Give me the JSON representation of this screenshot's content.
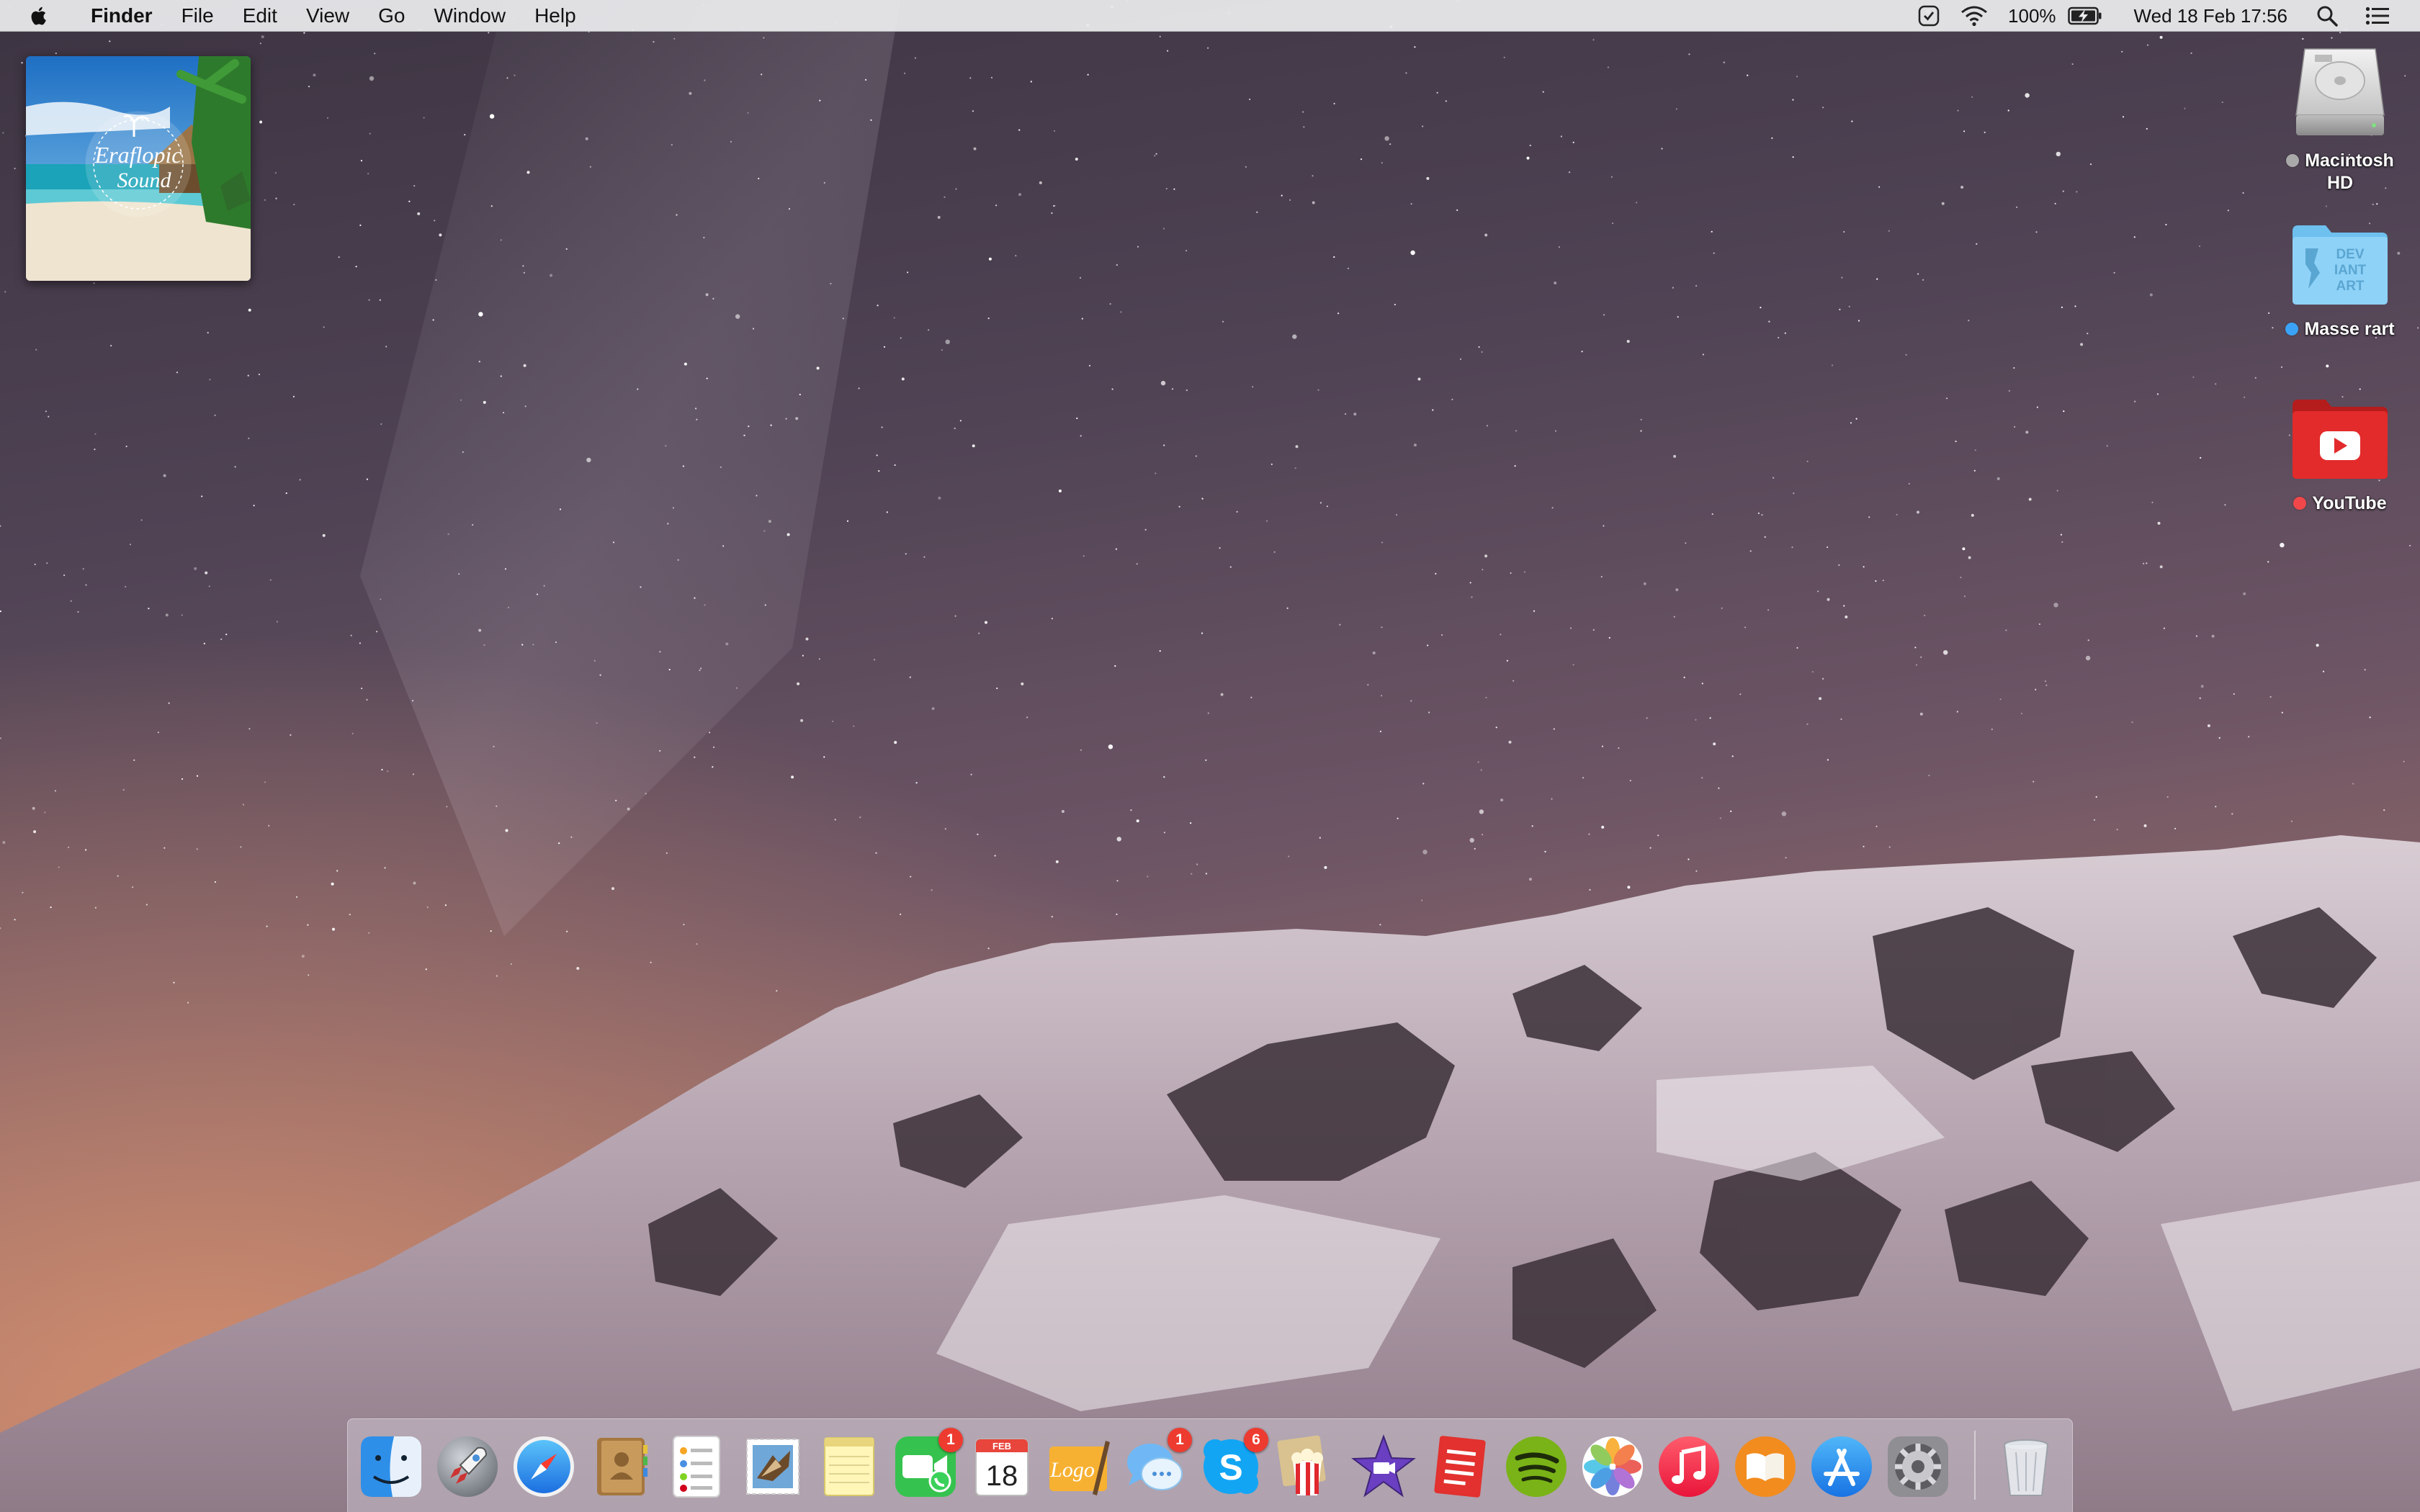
{
  "menubar": {
    "app_name": "Finder",
    "menus": [
      "File",
      "Edit",
      "View",
      "Go",
      "Window",
      "Help"
    ],
    "battery_percent": "100%",
    "datetime": "Wed 18 Feb  17:56",
    "status_icons": [
      "clock-check-icon",
      "wifi-icon",
      "battery-charging-icon",
      "spotlight-search-icon",
      "notification-center-icon"
    ]
  },
  "widgets": {
    "album_art": {
      "line1": "Eraflopic",
      "line2": "Sound"
    }
  },
  "desktop_icons": [
    {
      "name": "Macintosh HD",
      "label_lines": [
        "Macintosh",
        "HD"
      ],
      "tag_color": "#a9a9a9",
      "icon": "hard-drive-icon"
    },
    {
      "name": "Masse rart",
      "label_lines": [
        "Masse rart"
      ],
      "tag_color": "#3ba3f5",
      "icon": "deviantart-folder-icon",
      "folder_text": [
        "DEV",
        "IANT",
        "ART"
      ]
    },
    {
      "name": "YouTube",
      "label_lines": [
        "YouTube"
      ],
      "tag_color": "#f0484a",
      "icon": "youtube-folder-icon"
    }
  ],
  "dock": {
    "calendar_month": "FEB",
    "calendar_day": "18",
    "logo_app_text": "Logo",
    "apps": [
      {
        "id": "finder",
        "icon": "finder-icon",
        "running": true
      },
      {
        "id": "launchpad",
        "icon": "launchpad-rocket-icon",
        "running": false
      },
      {
        "id": "safari",
        "icon": "safari-compass-icon",
        "running": true
      },
      {
        "id": "contacts",
        "icon": "contacts-book-icon",
        "running": false
      },
      {
        "id": "reminders",
        "icon": "reminders-list-icon",
        "running": false
      },
      {
        "id": "mail",
        "icon": "mail-stamp-icon",
        "running": false
      },
      {
        "id": "notes",
        "icon": "notes-pad-icon",
        "running": false
      },
      {
        "id": "facetime",
        "icon": "facetime-icon",
        "running": true,
        "badge": "1"
      },
      {
        "id": "calendar",
        "icon": "calendar-icon",
        "running": true
      },
      {
        "id": "logoist",
        "icon": "logo-design-icon",
        "running": true
      },
      {
        "id": "messages",
        "icon": "messages-bubble-icon",
        "running": true,
        "badge": "1"
      },
      {
        "id": "skype",
        "icon": "skype-icon",
        "running": true,
        "badge": "6"
      },
      {
        "id": "popcorn",
        "icon": "popcorn-icon",
        "running": true
      },
      {
        "id": "imovie",
        "icon": "imovie-star-icon",
        "running": true
      },
      {
        "id": "todo",
        "icon": "todo-list-icon",
        "running": true
      },
      {
        "id": "spotify",
        "icon": "spotify-icon",
        "running": true
      },
      {
        "id": "photos",
        "icon": "photos-flower-icon",
        "running": true
      },
      {
        "id": "itunes",
        "icon": "itunes-note-icon",
        "running": true
      },
      {
        "id": "ibooks",
        "icon": "ibooks-icon",
        "running": false
      },
      {
        "id": "appstore",
        "icon": "app-store-icon",
        "running": true
      },
      {
        "id": "system-preferences",
        "icon": "system-preferences-gear-icon",
        "running": false
      },
      {
        "id": "trash",
        "icon": "trash-icon",
        "running": false
      }
    ]
  }
}
